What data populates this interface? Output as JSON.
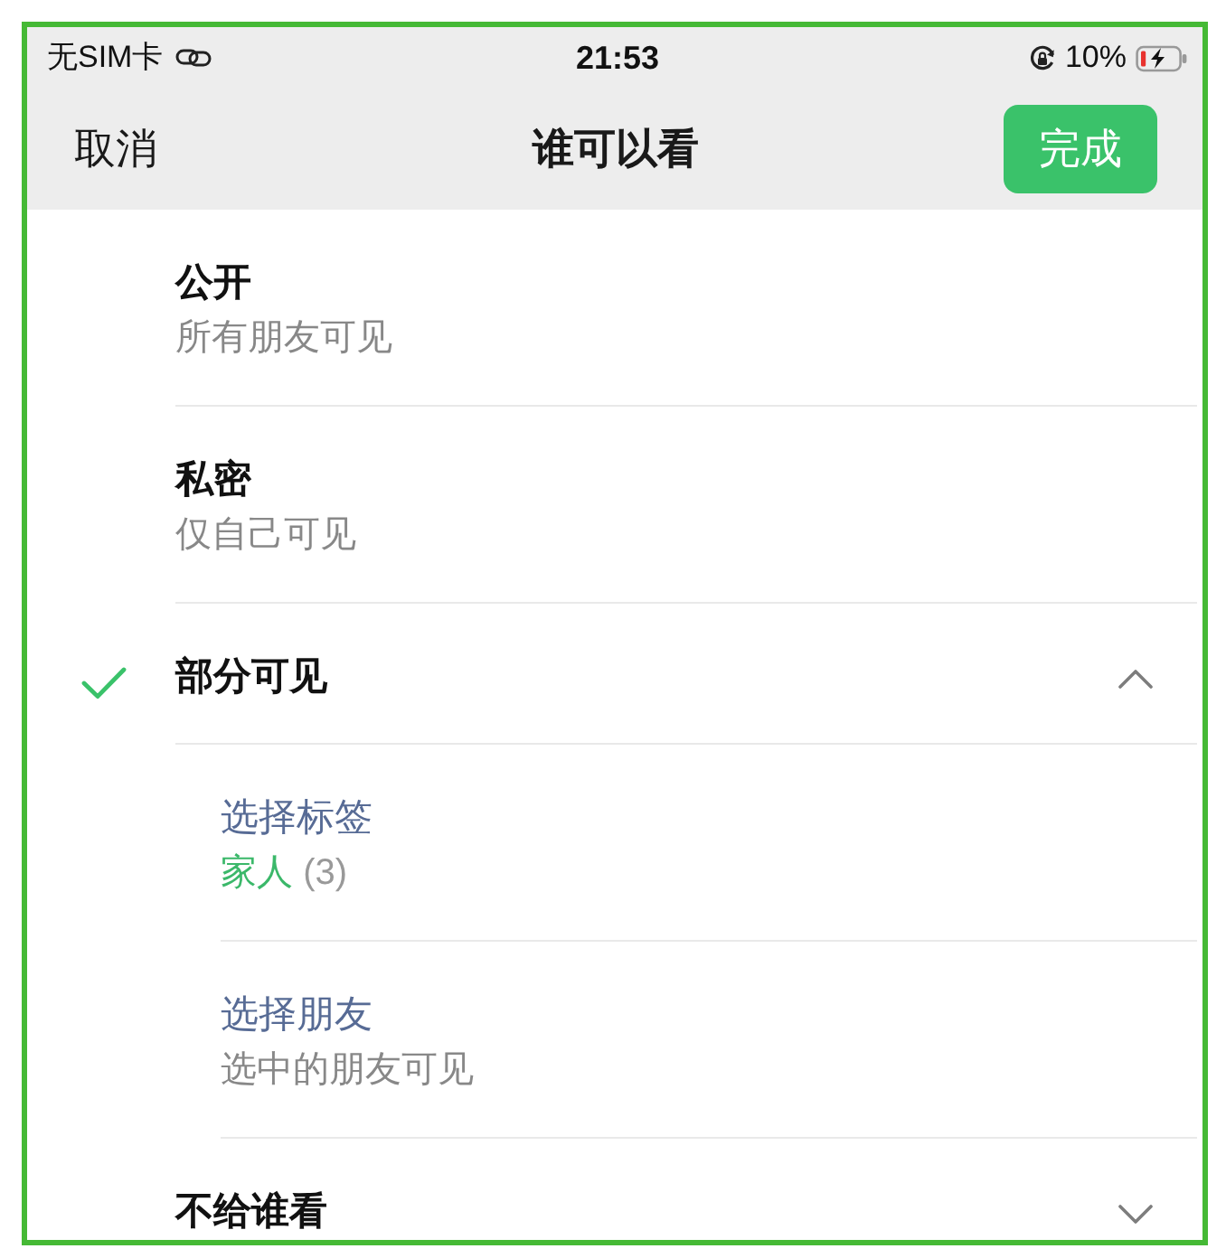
{
  "status_bar": {
    "carrier": "无SIM卡",
    "time": "21:53",
    "battery": "10%",
    "charging": true
  },
  "nav_bar": {
    "cancel": "取消",
    "title": "谁可以看",
    "done": "完成"
  },
  "options": [
    {
      "kind": "option",
      "title": "公开",
      "description": "所有朋友可见",
      "selected": false
    },
    {
      "kind": "option",
      "title": "私密",
      "description": "仅自己可见",
      "selected": false
    },
    {
      "kind": "group",
      "title": "部分可见",
      "selected": true,
      "expanded": true,
      "children": [
        {
          "title": "选择标签",
          "tag": "家人",
          "count": "(3)"
        },
        {
          "title": "选择朋友",
          "description": "选中的朋友可见"
        }
      ]
    },
    {
      "kind": "group",
      "title": "不给谁看",
      "selected": false,
      "expanded": false
    }
  ]
}
